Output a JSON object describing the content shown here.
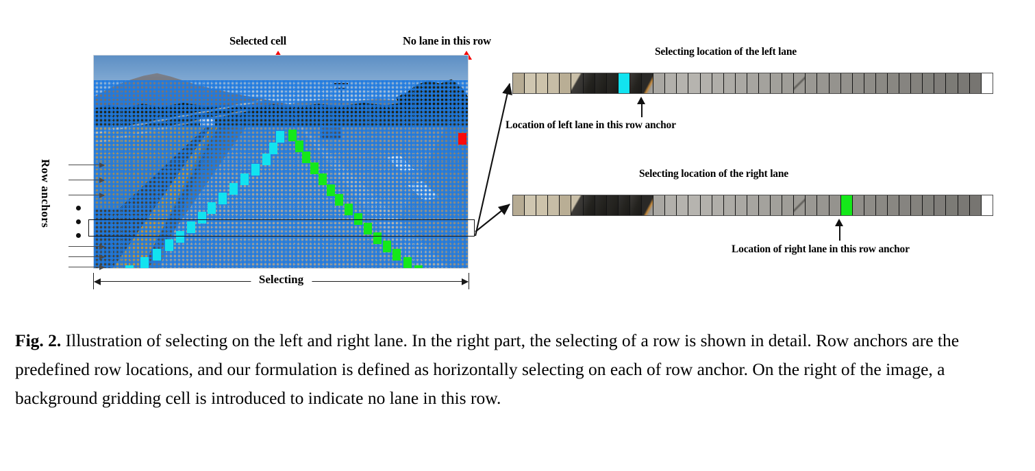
{
  "figure": {
    "number": "Fig. 2.",
    "caption": "Illustration of selecting on the left and right lane. In the right part, the selecting of a row is shown in detail. Row anchors are the predefined row locations, and our formulation is defined as horizontally selecting on each of row anchor. On the right of the image, a background gridding cell is introduced to indicate no lane in this row."
  },
  "left_panel": {
    "top_labels": {
      "selected_cell": "Selected cell",
      "no_lane": "No lane in this row"
    },
    "side_label": "Row anchors",
    "bottom_label": "Selecting",
    "grid": {
      "columns": 41,
      "rows": 21,
      "grid_color": "#1f7ae0"
    },
    "markers": {
      "left_lane_color": "#12e3f0",
      "right_lane_color": "#15e81a",
      "background_cell_color": "#fb0a0a",
      "arrow_color": "#f50000"
    }
  },
  "right_panel": {
    "top_strip": {
      "title": "Selecting location of the left lane",
      "annotation": "Location of left lane in this row anchor",
      "cell_count": 41,
      "selected_index": 9,
      "selected_color": "#12e3f0",
      "background_cell_index": 40,
      "background_cell_color": "#ffffff"
    },
    "bottom_strip": {
      "title": "Selecting location of the right lane",
      "annotation": "Location of right lane in this row anchor",
      "cell_count": 41,
      "selected_index": 28,
      "selected_color": "#15e81a",
      "background_cell_index": 40,
      "background_cell_color": "#ffffff"
    }
  }
}
